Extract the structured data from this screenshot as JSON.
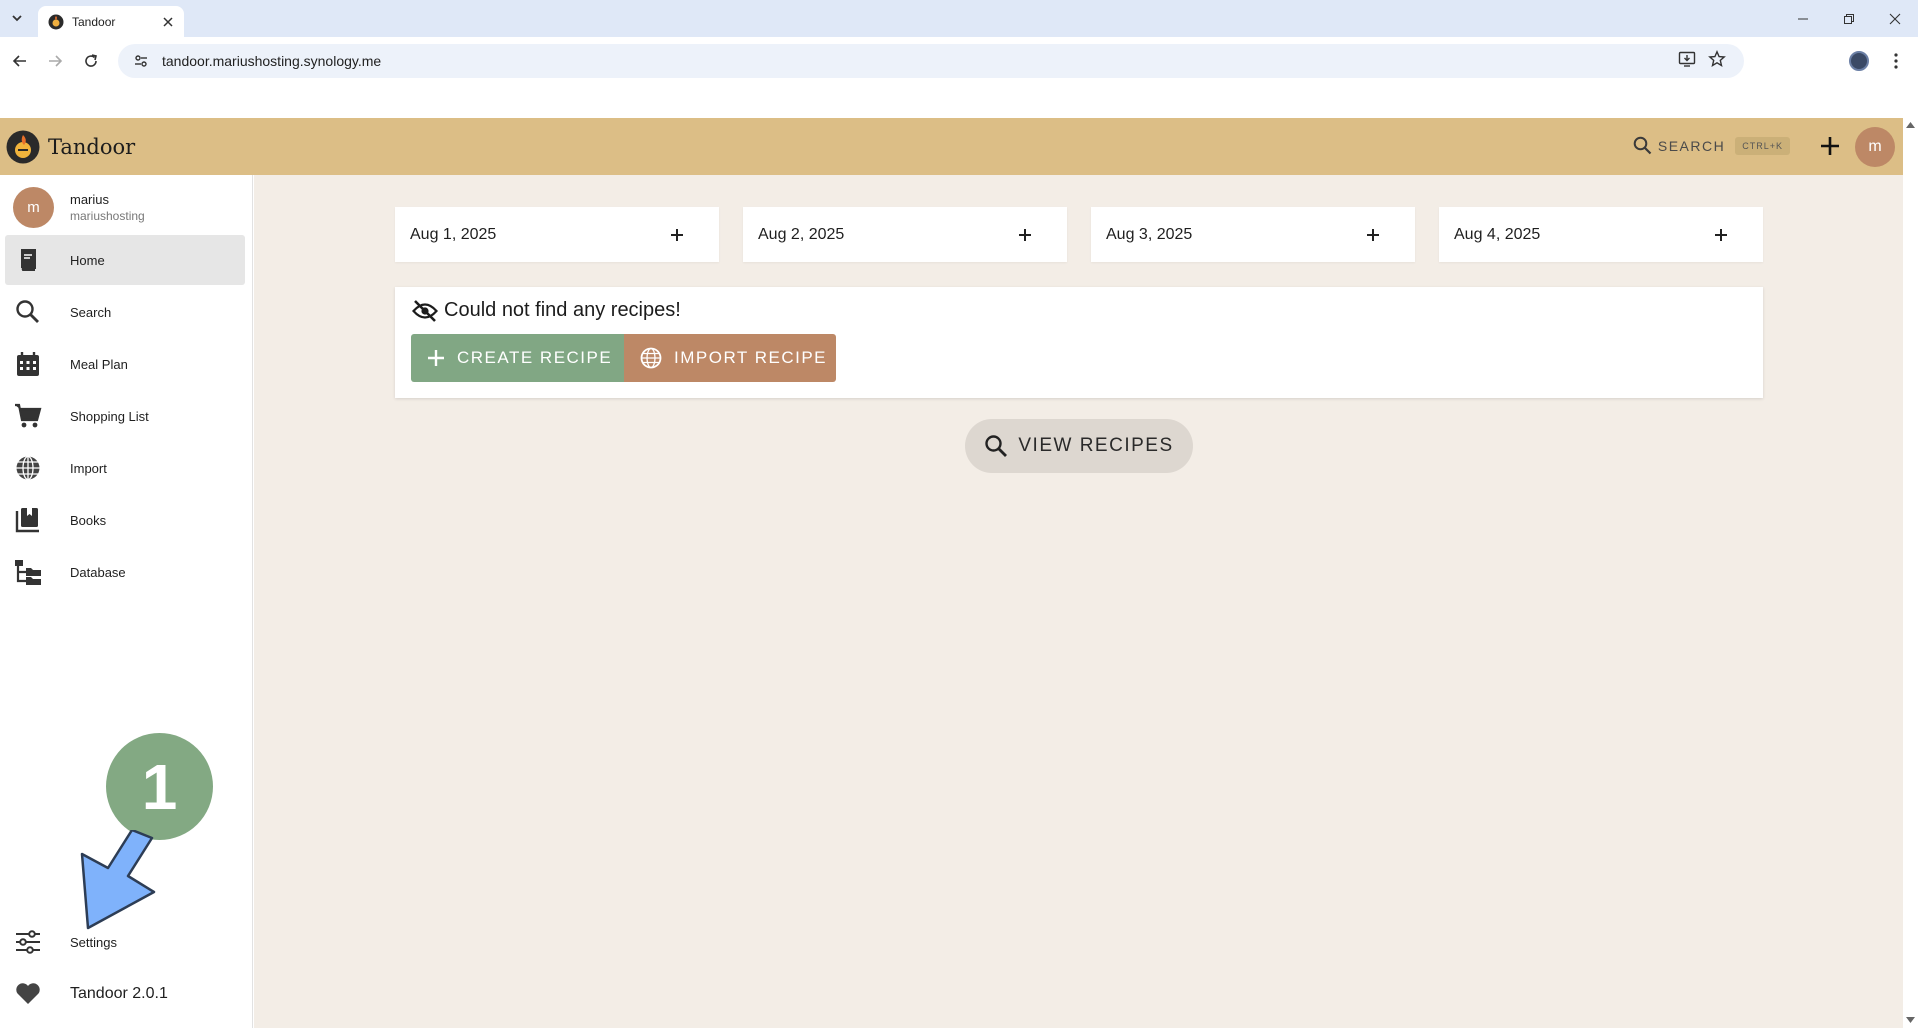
{
  "browser": {
    "tab_title": "Tandoor",
    "url": "tandoor.mariushosting.synology.me"
  },
  "app": {
    "brand": "Tandoor",
    "search_label": "SEARCH",
    "search_shortcut": "CTRL+K",
    "avatar_initial": "m",
    "colors": {
      "appbar": "#dcbe86",
      "primary_green": "#81a784",
      "accent_brown": "#bd8866",
      "background": "#f3ede6"
    }
  },
  "user": {
    "initial": "m",
    "name": "marius",
    "space": "mariushosting"
  },
  "sidebar": {
    "items": [
      {
        "label": "Home",
        "icon": "book-icon",
        "active": true
      },
      {
        "label": "Search",
        "icon": "search-icon"
      },
      {
        "label": "Meal Plan",
        "icon": "calendar-icon"
      },
      {
        "label": "Shopping List",
        "icon": "cart-icon"
      },
      {
        "label": "Import",
        "icon": "globe-icon"
      },
      {
        "label": "Books",
        "icon": "bookshelf-icon"
      },
      {
        "label": "Database",
        "icon": "folder-tree-icon"
      }
    ],
    "settings_label": "Settings",
    "version_label": "Tandoor 2.0.1"
  },
  "meal_plan": {
    "days": [
      "Aug 1, 2025",
      "Aug 2, 2025",
      "Aug 3, 2025",
      "Aug 4, 2025"
    ]
  },
  "empty_state": {
    "message": "Could not find any recipes!",
    "create_label": "CREATE RECIPE",
    "import_label": "IMPORT RECIPE"
  },
  "view_recipes_label": "VIEW RECIPES",
  "annotation": {
    "step_number": "1"
  }
}
